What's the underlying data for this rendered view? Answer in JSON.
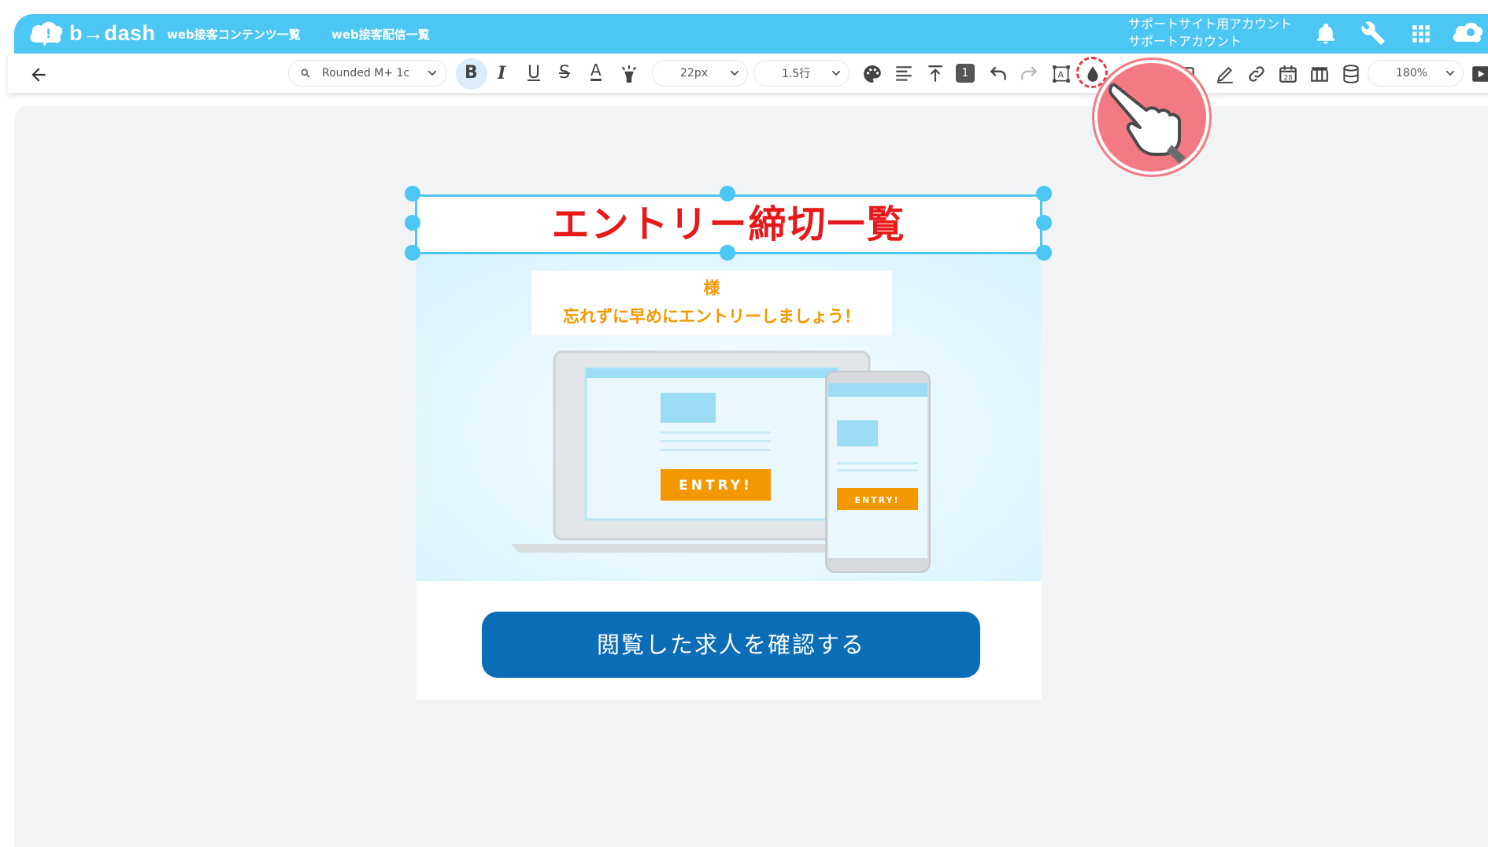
{
  "app": {
    "logo_text": "b→dash",
    "nav": [
      "web接客コンテンツ一覧",
      "web接客配信一覧"
    ],
    "account_line1": "サポートサイト用アカウント",
    "account_line2": "サポートアカウント"
  },
  "toolbar": {
    "font_family": "Rounded M+ 1c",
    "font_size": "22px",
    "line_height": "1.5行",
    "zoom": "180%",
    "badge_number": "1",
    "calendar_day": "28"
  },
  "email": {
    "title": "エントリー締切一覧",
    "sub_line1": "様",
    "sub_line2": "忘れずに早めにエントリーしましょう！",
    "entry_label_laptop": "ENTRY!",
    "entry_label_phone": "ENTRY!",
    "cta_label": "閲覧した求人を確認する"
  },
  "colors": {
    "header": "#4cc6f2",
    "title": "#e8191a",
    "subtext": "#f39800",
    "cta": "#0b6cb8",
    "pointer": "#f37a82"
  }
}
